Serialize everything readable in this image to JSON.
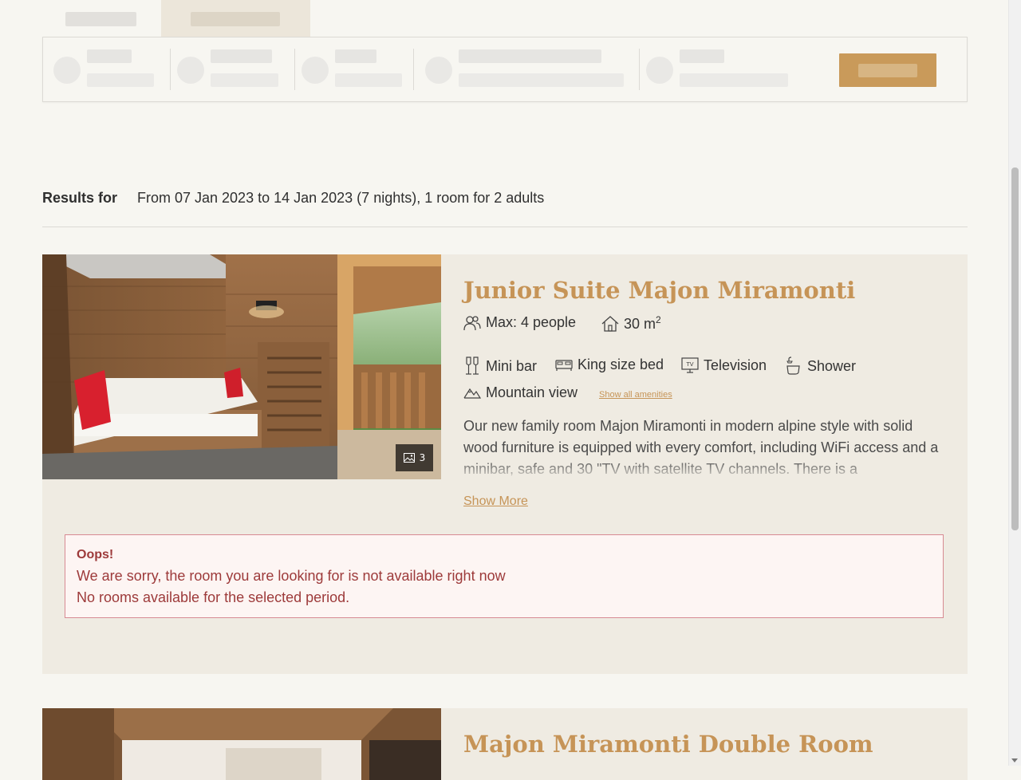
{
  "results": {
    "label": "Results for",
    "summary": "From 07 Jan 2023 to 14 Jan 2023 (7 nights), 1 room for 2 adults"
  },
  "rooms": [
    {
      "title": "Junior Suite Majon Miramonti",
      "photo_count": "3",
      "max_people": "Max: 4 people",
      "size_value": "30 m",
      "size_unit_sup": "2",
      "amenities": [
        "Mini bar",
        "King size bed",
        "Television",
        "Shower",
        "Mountain view"
      ],
      "show_all_amenities": "Show all amenities",
      "description": "Our new family room Majon Miramonti in modern alpine style with solid wood furniture is equipped with every comfort, including WiFi access and a minibar, safe and 30 \"TV with satellite TV channels. There is a",
      "show_more": "Show More",
      "alert": {
        "title": "Oops!",
        "line1": "We are sorry, the room you are looking for is not available right now",
        "line2": "No rooms available for the selected period."
      }
    },
    {
      "title": "Majon Miramonti Double Room"
    }
  ],
  "colors": {
    "accent": "#c69457",
    "card_bg": "#efebe2",
    "page_bg": "#f7f6f1",
    "alert_text": "#9d3a3a",
    "alert_border": "#d78a93"
  },
  "icons": {
    "people": "people-icon",
    "house": "house-icon",
    "minibar": "wine-glasses-icon",
    "bed": "bed-icon",
    "tv": "tv-icon",
    "shower": "shower-icon",
    "mountain": "mountain-icon",
    "image": "image-icon"
  }
}
